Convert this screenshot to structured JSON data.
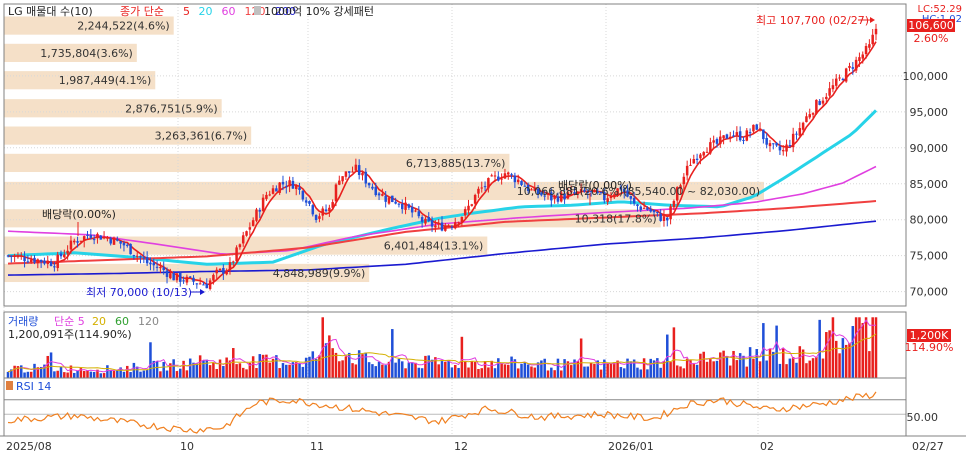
{
  "header": {
    "title": "LG 매물대 수(10)",
    "legend_main": [
      {
        "label": "종가 단순",
        "color": "#e8201e"
      },
      {
        "label": "5",
        "color": "#e8201e"
      },
      {
        "label": "20",
        "color": "#27d3e8"
      },
      {
        "label": "60",
        "color": "#e040e0"
      },
      {
        "label": "120",
        "color": "#f04040"
      },
      {
        "label": "200",
        "color": "#1a1ad0"
      }
    ],
    "pattern_label": "1000억 10% 강세패턴",
    "lc_label": "LC:52.29",
    "hc_label": "HC:1.02"
  },
  "price_labels": {
    "last_price": "106,600",
    "change_pct": "2.60%",
    "high_annotation": "최고 107,700 (02/27)",
    "low_annotation": "최저 70,000 (10/13)",
    "dividend_1": "배당락(0.00%)",
    "dividend_2": "배당락(0.00%)"
  },
  "volume_panel": {
    "legend_title": "거래량",
    "legend_ma": [
      {
        "label": "단순 5",
        "color": "#e040e0"
      },
      {
        "label": "20",
        "color": "#d4b000"
      },
      {
        "label": "60",
        "color": "#30a030"
      },
      {
        "label": "120",
        "color": "#888888"
      }
    ],
    "current": "1,200,091주(114.90%)",
    "axis_badge": "1,200K",
    "axis_pct": "114.90%"
  },
  "rsi_panel": {
    "legend": "RSI 14",
    "axis_label": "50.00"
  },
  "x_labels": [
    "2025/08",
    "10",
    "11",
    "12",
    "2026/01",
    "02",
    "02/27"
  ],
  "colors": {
    "up": "#e8201e",
    "down": "#1f4fd8",
    "volume_profile": "#f5e0c8",
    "grid": "#d8d8d8"
  },
  "chart_data": {
    "type": "candlestick",
    "title": "LG 매물대 수(10)",
    "y_axis": {
      "min": 68000,
      "max": 110000,
      "ticks": [
        "100,000",
        "95,000",
        "90,000",
        "85,000",
        "80,000",
        "75,000",
        "70,000"
      ]
    },
    "volume_profile": [
      {
        "label": "2,244,522(4.6%)",
        "price": 107000,
        "share": 4.6
      },
      {
        "label": "1,735,804(3.6%)",
        "price": 103200,
        "share": 3.6
      },
      {
        "label": "1,987,449(4.1%)",
        "price": 99400,
        "share": 4.1
      },
      {
        "label": "2,876,751(5.9%)",
        "price": 95500,
        "share": 5.9
      },
      {
        "label": "3,263,361(6.7%)",
        "price": 91700,
        "share": 6.7
      },
      {
        "label": "6,713,885(13.7%)",
        "price": 87900,
        "share": 13.7
      },
      {
        "label": "10,066,881(20.6%)(85,540.00 ~ 82,030.00)",
        "price": 84000,
        "share": 20.6
      },
      {
        "label": "10,318(17.8%)",
        "price": 80200,
        "share": 17.8
      },
      {
        "label": "6,401,484(13.1%)",
        "price": 76400,
        "share": 13.1
      },
      {
        "label": "4,848,989(9.9%)",
        "price": 72600,
        "share": 9.9
      }
    ],
    "ma_series": [
      {
        "name": "20",
        "color": "#27d3e8",
        "points": [
          [
            0,
            75000
          ],
          [
            20,
            75400
          ],
          [
            40,
            74700
          ],
          [
            60,
            73800
          ],
          [
            80,
            74100
          ],
          [
            95,
            76500
          ],
          [
            115,
            78700
          ],
          [
            130,
            80200
          ],
          [
            140,
            80900
          ],
          [
            155,
            81800
          ],
          [
            170,
            82000
          ],
          [
            185,
            82500
          ],
          [
            200,
            82000
          ],
          [
            215,
            81800
          ],
          [
            225,
            83200
          ],
          [
            235,
            86000
          ],
          [
            245,
            89000
          ],
          [
            255,
            92000
          ],
          [
            262,
            95200
          ]
        ]
      },
      {
        "name": "60",
        "color": "#e040e0",
        "points": [
          [
            0,
            78400
          ],
          [
            25,
            77900
          ],
          [
            45,
            76600
          ],
          [
            65,
            75200
          ],
          [
            85,
            75700
          ],
          [
            105,
            77700
          ],
          [
            130,
            79400
          ],
          [
            155,
            80300
          ],
          [
            180,
            81000
          ],
          [
            205,
            81600
          ],
          [
            225,
            82400
          ],
          [
            240,
            83600
          ],
          [
            252,
            85100
          ],
          [
            262,
            87400
          ]
        ]
      },
      {
        "name": "120",
        "color": "#f04040",
        "points": [
          [
            0,
            73900
          ],
          [
            30,
            74400
          ],
          [
            60,
            74900
          ],
          [
            90,
            76100
          ],
          [
            120,
            78300
          ],
          [
            150,
            79700
          ],
          [
            180,
            80300
          ],
          [
            210,
            80900
          ],
          [
            235,
            81600
          ],
          [
            262,
            82600
          ]
        ]
      },
      {
        "name": "200",
        "color": "#1a1ad0",
        "points": [
          [
            0,
            72300
          ],
          [
            30,
            72500
          ],
          [
            60,
            72800
          ],
          [
            90,
            73000
          ],
          [
            120,
            73800
          ],
          [
            150,
            75300
          ],
          [
            180,
            76600
          ],
          [
            210,
            77500
          ],
          [
            235,
            78500
          ],
          [
            262,
            79800
          ]
        ]
      }
    ],
    "anchors": [
      [
        0,
        75000
      ],
      [
        8,
        74500
      ],
      [
        14,
        74000
      ],
      [
        20,
        77000
      ],
      [
        25,
        78000
      ],
      [
        30,
        77500
      ],
      [
        35,
        76500
      ],
      [
        42,
        74000
      ],
      [
        47,
        73000
      ],
      [
        50,
        72000
      ],
      [
        55,
        71500
      ],
      [
        60,
        71000
      ],
      [
        63,
        72500
      ],
      [
        67,
        73500
      ],
      [
        70,
        76500
      ],
      [
        74,
        80000
      ],
      [
        78,
        83500
      ],
      [
        82,
        85000
      ],
      [
        86,
        85000
      ],
      [
        90,
        83000
      ],
      [
        93,
        80500
      ],
      [
        97,
        81500
      ],
      [
        100,
        86000
      ],
      [
        105,
        87000
      ],
      [
        110,
        84500
      ],
      [
        114,
        83000
      ],
      [
        118,
        82500
      ],
      [
        122,
        81000
      ],
      [
        126,
        79500
      ],
      [
        130,
        79000
      ],
      [
        134,
        79500
      ],
      [
        138,
        81000
      ],
      [
        142,
        84000
      ],
      [
        146,
        85500
      ],
      [
        150,
        86500
      ],
      [
        154,
        85500
      ],
      [
        158,
        84000
      ],
      [
        164,
        83000
      ],
      [
        170,
        83500
      ],
      [
        175,
        83800
      ],
      [
        180,
        83000
      ],
      [
        185,
        84500
      ],
      [
        189,
        82000
      ],
      [
        193,
        81500
      ],
      [
        196,
        80500
      ],
      [
        199,
        80000
      ],
      [
        202,
        84000
      ],
      [
        206,
        88000
      ],
      [
        210,
        90000
      ],
      [
        214,
        90500
      ],
      [
        218,
        92000
      ],
      [
        222,
        91500
      ],
      [
        226,
        93000
      ],
      [
        230,
        90000
      ],
      [
        234,
        89500
      ],
      [
        238,
        92000
      ],
      [
        242,
        95000
      ],
      [
        246,
        97000
      ],
      [
        250,
        99000
      ],
      [
        254,
        101000
      ],
      [
        258,
        103000
      ],
      [
        260,
        104000
      ],
      [
        262,
        106600
      ]
    ],
    "volume_anchors": [
      [
        0,
        0.16
      ],
      [
        30,
        0.14
      ],
      [
        60,
        0.24
      ],
      [
        90,
        0.28
      ],
      [
        98,
        0.48
      ],
      [
        110,
        0.24
      ],
      [
        140,
        0.25
      ],
      [
        175,
        0.2
      ],
      [
        200,
        0.26
      ],
      [
        215,
        0.32
      ],
      [
        240,
        0.36
      ],
      [
        262,
        0.86
      ]
    ],
    "rsi_anchors": [
      [
        0,
        42
      ],
      [
        20,
        48
      ],
      [
        40,
        36
      ],
      [
        55,
        28
      ],
      [
        65,
        32
      ],
      [
        75,
        66
      ],
      [
        85,
        70
      ],
      [
        100,
        60
      ],
      [
        115,
        50
      ],
      [
        130,
        40
      ],
      [
        145,
        58
      ],
      [
        160,
        46
      ],
      [
        180,
        50
      ],
      [
        195,
        44
      ],
      [
        205,
        64
      ],
      [
        215,
        70
      ],
      [
        230,
        56
      ],
      [
        245,
        64
      ],
      [
        262,
        78
      ]
    ]
  }
}
